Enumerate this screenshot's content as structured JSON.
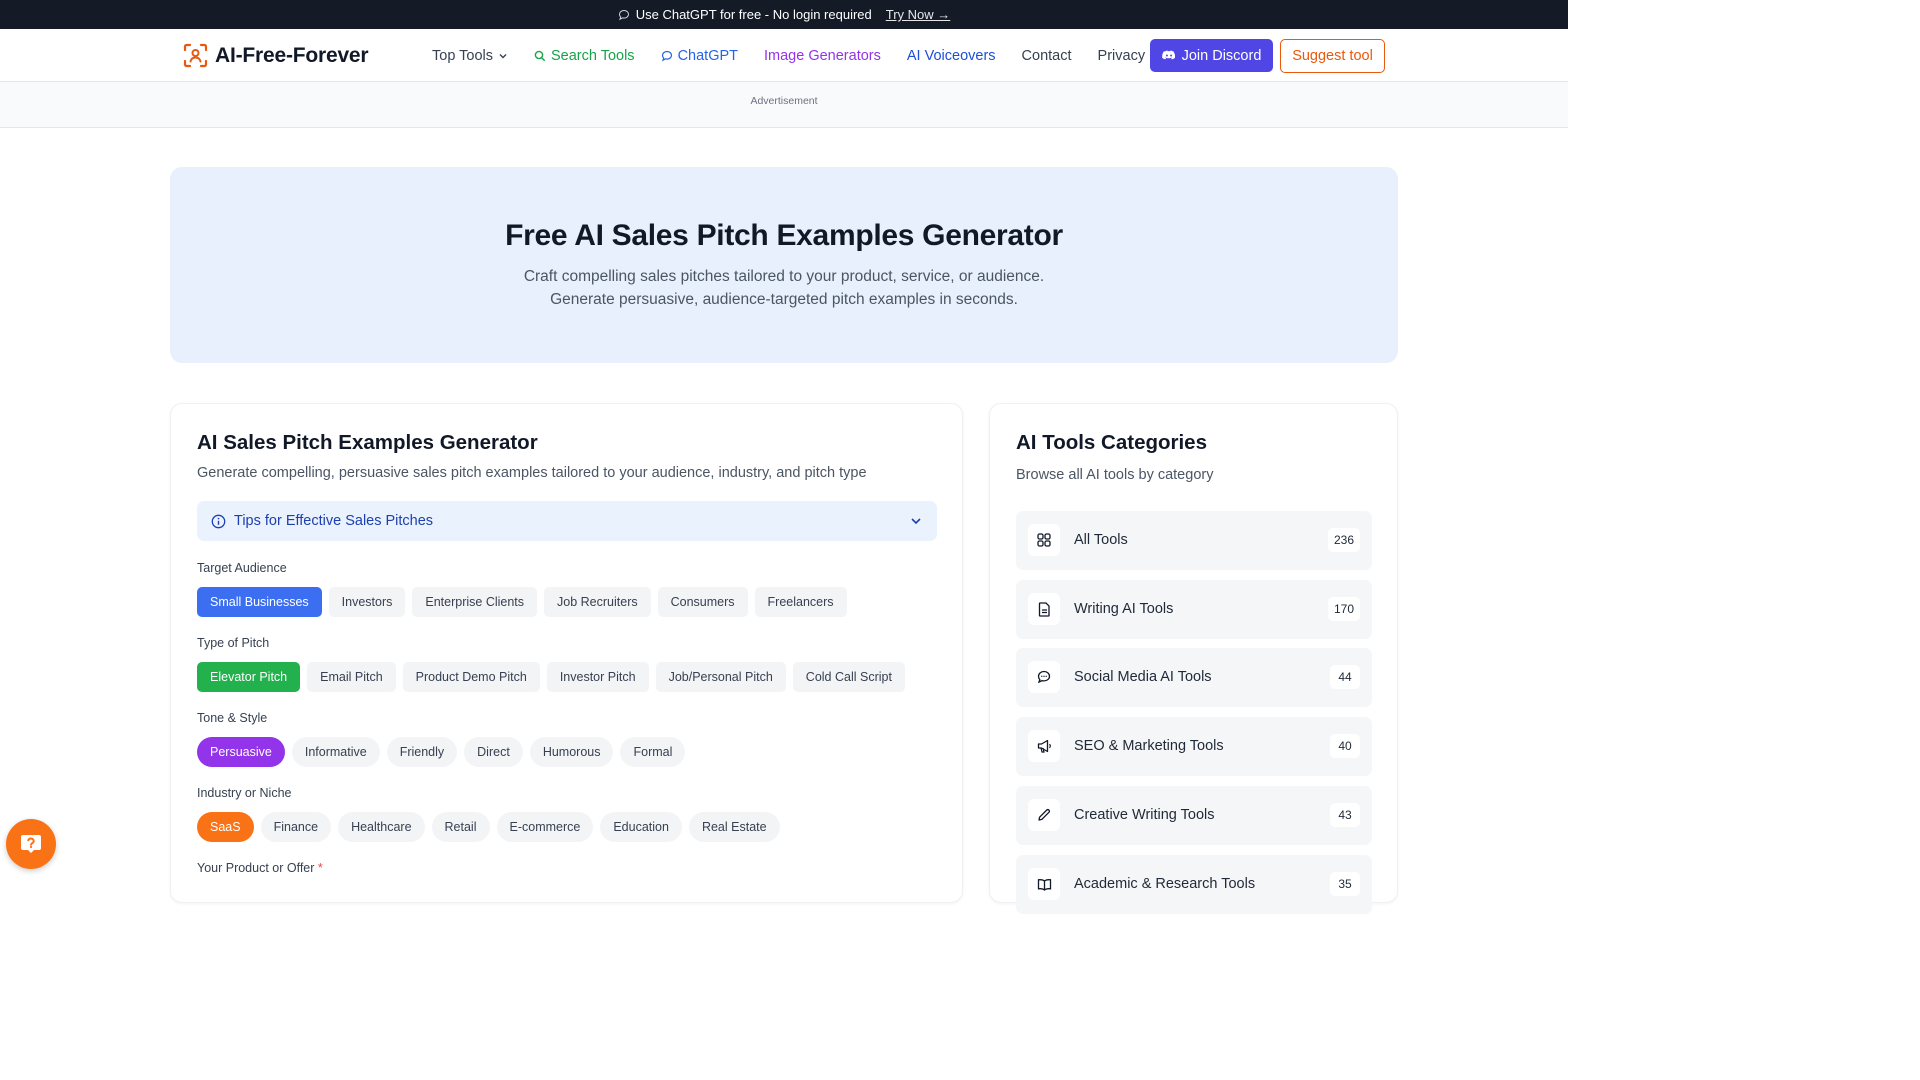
{
  "announcement": {
    "text": "Use ChatGPT for free - No login required",
    "link": "Try Now →"
  },
  "nav": {
    "logo": "AI-Free-Forever",
    "links": {
      "top_tools": "Top Tools",
      "search_tools": "Search Tools",
      "chatgpt": "ChatGPT",
      "image_generators": "Image Generators",
      "ai_voiceovers": "AI Voiceovers",
      "contact": "Contact",
      "privacy": "Privacy"
    },
    "join_discord": "Join Discord",
    "suggest_tool": "Suggest tool"
  },
  "ad_label": "Advertisement",
  "hero": {
    "title": "Free AI Sales Pitch Examples Generator",
    "line1": "Craft compelling sales pitches tailored to your product, service, or audience.",
    "line2": "Generate persuasive, audience-targeted pitch examples in seconds."
  },
  "generator": {
    "title": "AI Sales Pitch Examples Generator",
    "subtitle": "Generate compelling, persuasive sales pitch examples tailored to your audience, industry, and pitch type",
    "tips": "Tips for Effective Sales Pitches",
    "audience": {
      "label": "Target Audience",
      "options": [
        "Small Businesses",
        "Investors",
        "Enterprise Clients",
        "Job Recruiters",
        "Consumers",
        "Freelancers"
      ],
      "selected": "Small Businesses"
    },
    "pitch_type": {
      "label": "Type of Pitch",
      "options": [
        "Elevator Pitch",
        "Email Pitch",
        "Product Demo Pitch",
        "Investor Pitch",
        "Job/Personal Pitch",
        "Cold Call Script"
      ],
      "selected": "Elevator Pitch"
    },
    "tone": {
      "label": "Tone & Style",
      "options": [
        "Persuasive",
        "Informative",
        "Friendly",
        "Direct",
        "Humorous",
        "Formal"
      ],
      "selected": "Persuasive"
    },
    "industry": {
      "label": "Industry or Niche",
      "options": [
        "SaaS",
        "Finance",
        "Healthcare",
        "Retail",
        "E-commerce",
        "Education",
        "Real Estate"
      ],
      "selected": "SaaS"
    },
    "product_label": "Your Product or Offer",
    "required_mark": "*"
  },
  "categories": {
    "title": "AI Tools Categories",
    "subtitle": "Browse all AI tools by category",
    "items": [
      {
        "name": "All Tools",
        "count": "236",
        "icon": "grid-icon"
      },
      {
        "name": "Writing AI Tools",
        "count": "170",
        "icon": "document-icon"
      },
      {
        "name": "Social Media AI Tools",
        "count": "44",
        "icon": "chat-bubble-icon"
      },
      {
        "name": "SEO & Marketing Tools",
        "count": "40",
        "icon": "megaphone-icon"
      },
      {
        "name": "Creative Writing Tools",
        "count": "43",
        "icon": "pencil-icon"
      },
      {
        "name": "Academic & Research Tools",
        "count": "35",
        "icon": "book-icon"
      }
    ]
  },
  "colors": {
    "accent_blue": "#3b6ef0",
    "accent_green": "#22b14c",
    "accent_purple": "#9333ea",
    "accent_orange": "#f97316",
    "discord": "#4f46e5"
  }
}
